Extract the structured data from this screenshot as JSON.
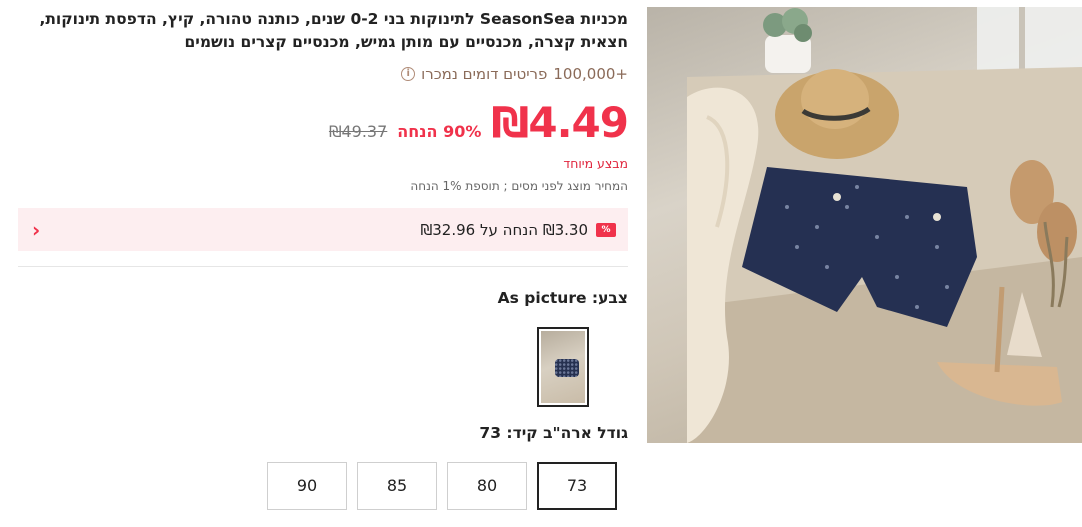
{
  "product": {
    "title": "מכניות SeasonSea לתינוקות בני 0-2 שנים, כותנה טהורה, קיץ, הדפסת תינוקות, חצאית קצרה, מכנסיים עם מותן גמיש, מכנסיים קצרים נושמים",
    "sold_count": "+100,000",
    "sold_label": "פריטים דומים נמכרו",
    "price": "₪4.49",
    "discount": "90% הנחה",
    "original_price": "₪49.37",
    "special_offer": "מבצע מיוחד",
    "tax_note": "המחיר מוצג לפני מסים ; תוספת 1% הנחה"
  },
  "coupon": {
    "badge": "%",
    "text": "₪3.30 הנחה על ₪32.96",
    "chevron": "‹"
  },
  "color": {
    "label": "צבע: As picture"
  },
  "size": {
    "label": "גודל ארה\"ב קיד: 73",
    "options": [
      "73",
      "80",
      "85",
      "90"
    ],
    "selected": "73"
  },
  "icons": {
    "info": "info-icon",
    "coupon_badge": "percent-badge-icon",
    "chevron": "chevron-left-icon"
  },
  "colors": {
    "accent": "#f0324b",
    "coupon_bg": "#fdeef0"
  }
}
